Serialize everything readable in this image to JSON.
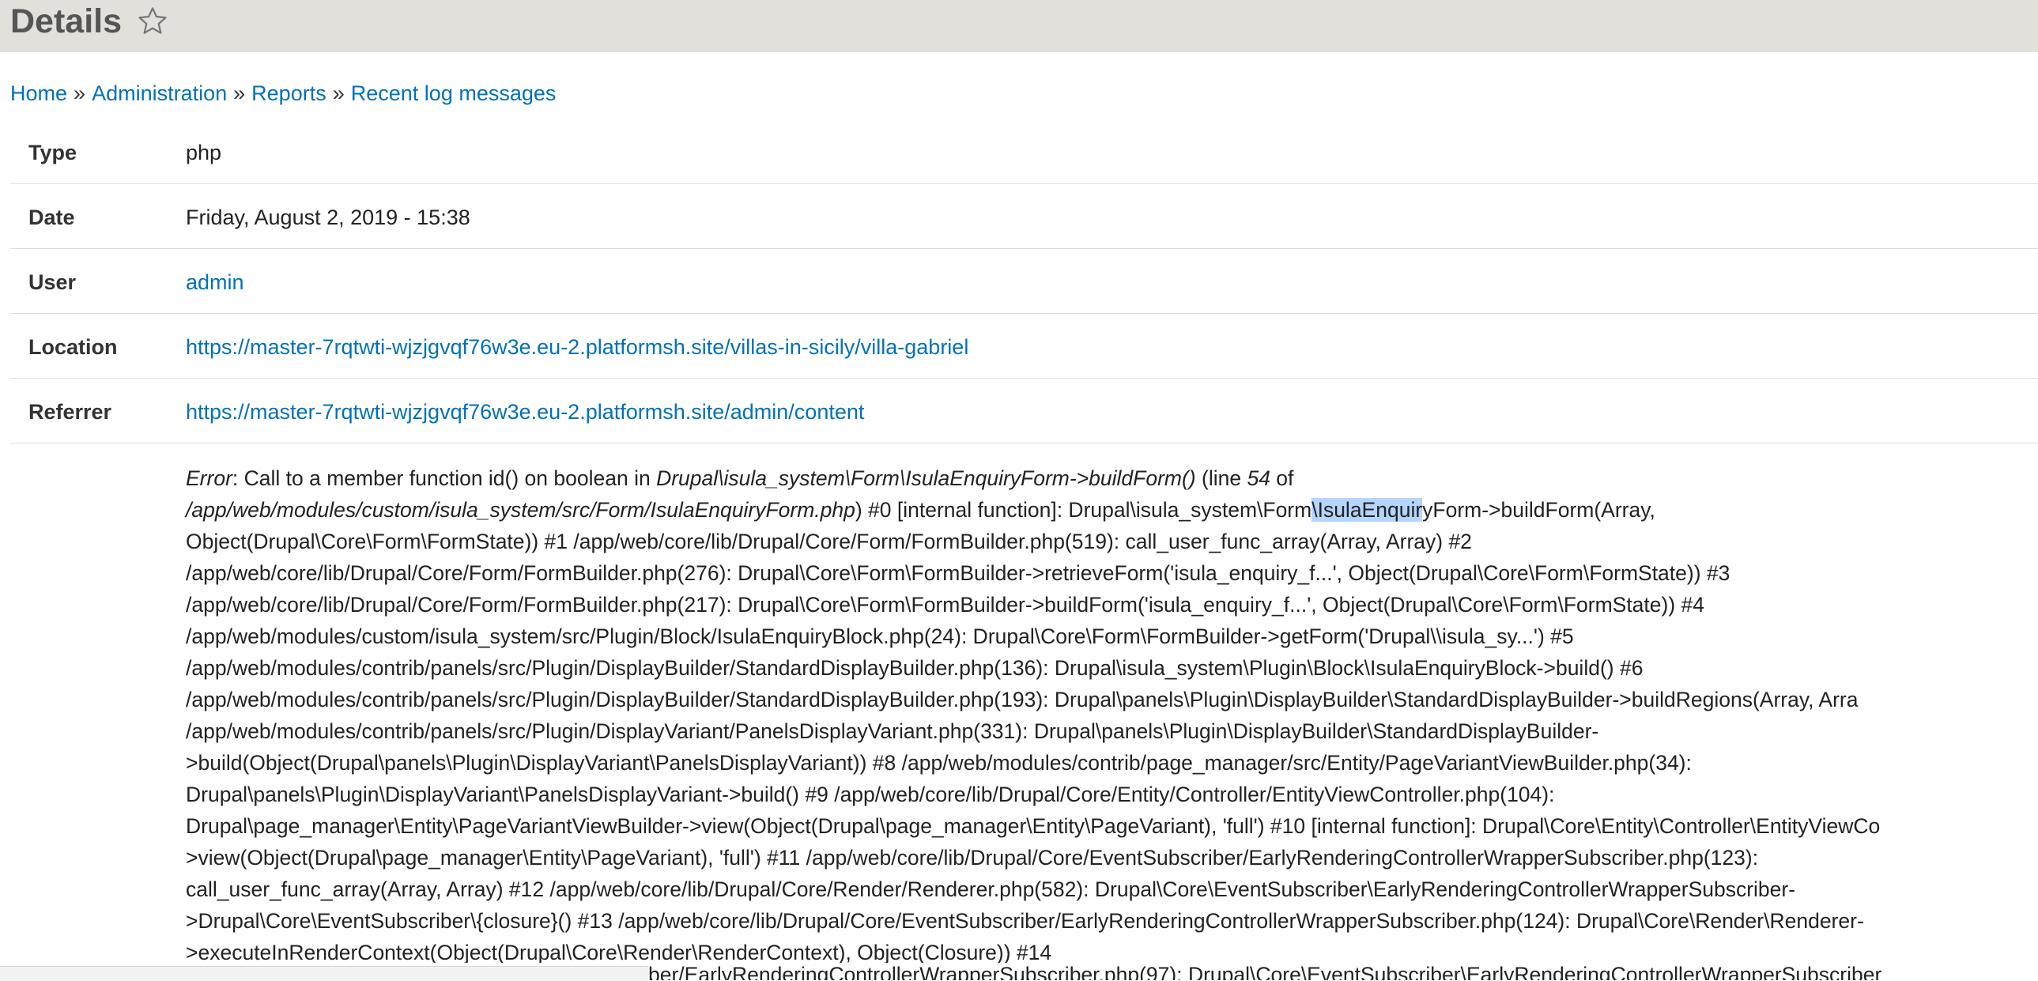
{
  "header": {
    "title": "Details"
  },
  "breadcrumb": {
    "items": [
      "Home",
      "Administration",
      "Reports",
      "Recent log messages"
    ],
    "separator": "»"
  },
  "details": {
    "type_label": "Type",
    "type_value": "php",
    "date_label": "Date",
    "date_value": "Friday, August 2, 2019 - 15:38",
    "user_label": "User",
    "user_value": "admin",
    "location_label": "Location",
    "location_value": "https://master-7rqtwti-wjzjgvqf76w3e.eu-2.platformsh.site/villas-in-sicily/villa-gabriel",
    "referrer_label": "Referrer",
    "referrer_value": "https://master-7rqtwti-wjzjgvqf76w3e.eu-2.platformsh.site/admin/content"
  },
  "message": {
    "l1_error": "Error",
    "l1_a": ": Call to a member function id() on boolean in ",
    "l1_fn": "Drupal\\isula_system\\Form\\IsulaEnquiryForm->buildForm()",
    "l1_b": " (line ",
    "l1_line": "54",
    "l1_c": " of",
    "l2_path": "/app/web/modules/custom/isula_system/src/Form/IsulaEnquiryForm.php",
    "l2_a": ") #0 [internal function]: Drupal\\isula_system\\Form",
    "l2_hl": "\\IsulaEnquir",
    "l2_b": "yForm->buildForm(Array,",
    "l3": "Object(Drupal\\Core\\Form\\FormState)) #1 /app/web/core/lib/Drupal/Core/Form/FormBuilder.php(519): call_user_func_array(Array, Array) #2",
    "l4": "/app/web/core/lib/Drupal/Core/Form/FormBuilder.php(276): Drupal\\Core\\Form\\FormBuilder->retrieveForm('isula_enquiry_f...', Object(Drupal\\Core\\Form\\FormState)) #3",
    "l5": "/app/web/core/lib/Drupal/Core/Form/FormBuilder.php(217): Drupal\\Core\\Form\\FormBuilder->buildForm('isula_enquiry_f...', Object(Drupal\\Core\\Form\\FormState)) #4",
    "l6": "/app/web/modules/custom/isula_system/src/Plugin/Block/IsulaEnquiryBlock.php(24): Drupal\\Core\\Form\\FormBuilder->getForm('Drupal\\\\isula_sy...') #5",
    "l7": "/app/web/modules/contrib/panels/src/Plugin/DisplayBuilder/StandardDisplayBuilder.php(136): Drupal\\isula_system\\Plugin\\Block\\IsulaEnquiryBlock->build() #6",
    "l8": "/app/web/modules/contrib/panels/src/Plugin/DisplayBuilder/StandardDisplayBuilder.php(193): Drupal\\panels\\Plugin\\DisplayBuilder\\StandardDisplayBuilder->buildRegions(Array, Arra",
    "l9": "/app/web/modules/contrib/panels/src/Plugin/DisplayVariant/PanelsDisplayVariant.php(331): Drupal\\panels\\Plugin\\DisplayBuilder\\StandardDisplayBuilder-",
    "l10": ">build(Object(Drupal\\panels\\Plugin\\DisplayVariant\\PanelsDisplayVariant)) #8 /app/web/modules/contrib/page_manager/src/Entity/PageVariantViewBuilder.php(34):",
    "l11": "Drupal\\panels\\Plugin\\DisplayVariant\\PanelsDisplayVariant->build() #9 /app/web/core/lib/Drupal/Core/Entity/Controller/EntityViewController.php(104):",
    "l12": "Drupal\\page_manager\\Entity\\PageVariantViewBuilder->view(Object(Drupal\\page_manager\\Entity\\PageVariant), 'full') #10 [internal function]: Drupal\\Core\\Entity\\Controller\\EntityViewCo",
    "l13": ">view(Object(Drupal\\page_manager\\Entity\\PageVariant), 'full') #11 /app/web/core/lib/Drupal/Core/EventSubscriber/EarlyRenderingControllerWrapperSubscriber.php(123):",
    "l14": "call_user_func_array(Array, Array) #12 /app/web/core/lib/Drupal/Core/Render/Renderer.php(582): Drupal\\Core\\EventSubscriber\\EarlyRenderingControllerWrapperSubscriber-",
    "l15": ">Drupal\\Core\\EventSubscriber\\{closure}() #13 /app/web/core/lib/Drupal/Core/EventSubscriber/EarlyRenderingControllerWrapperSubscriber.php(124): Drupal\\Core\\Render\\Renderer-",
    "l16": ">executeInRenderContext(Object(Drupal\\Core\\Render\\RenderContext), Object(Closure)) #14",
    "l17_clipped": "ber/EarlyRenderingControllerWrapperSubscriber.php(97): Drupal\\Core\\EventSubscriber\\EarlyRenderingControllerWrapperSubscriber"
  },
  "colors": {
    "header_bg": "#e1e0da",
    "link": "#0071b8",
    "selection": "#b4d5fe"
  },
  "icons": {
    "shortcut": "star-outline-icon"
  }
}
